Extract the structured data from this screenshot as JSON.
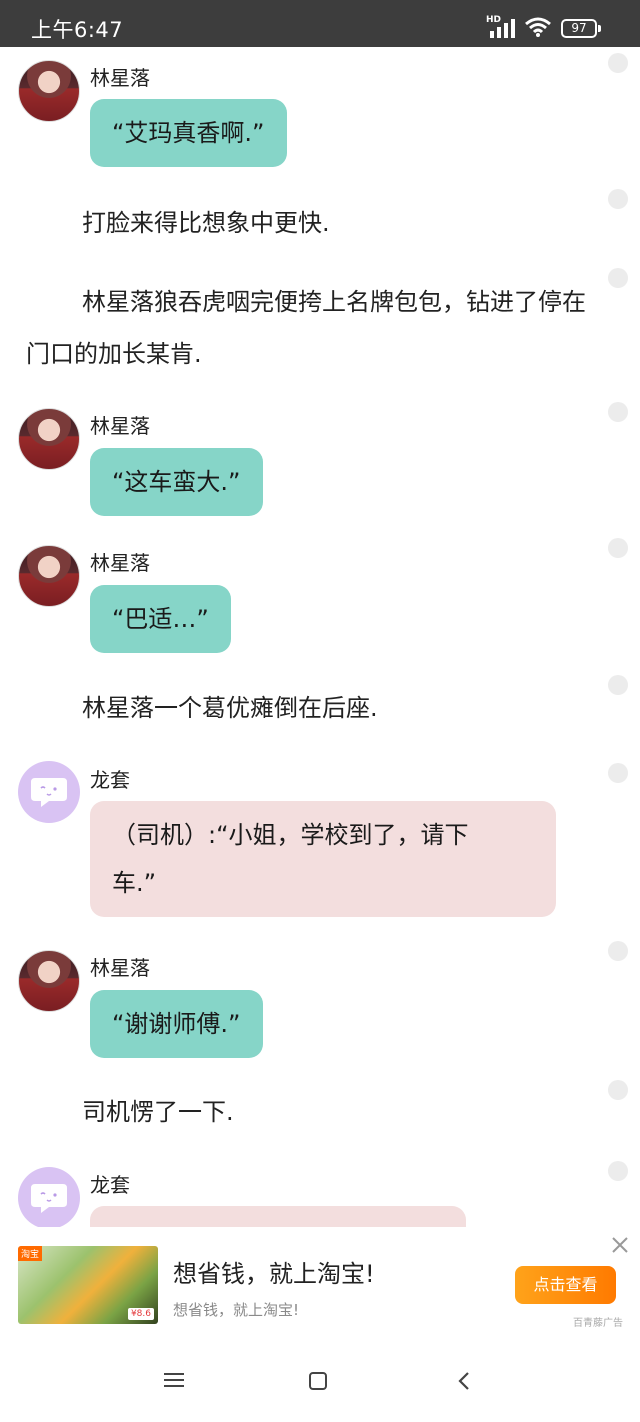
{
  "status_bar": {
    "time": "上午6:47",
    "network": "HD",
    "battery": "97"
  },
  "feed": [
    {
      "type": "chat",
      "speaker": "林星落",
      "avatar": "girl-photo",
      "text": "“艾玛真香啊.”",
      "style": "teal"
    },
    {
      "type": "narration",
      "text": "打脸来得比想象中更快."
    },
    {
      "type": "narration",
      "text": "林星落狼吞虎咽完便挎上名牌包包，钻进了停在门口的加长某肯."
    },
    {
      "type": "chat",
      "speaker": "林星落",
      "avatar": "girl-photo",
      "text": "“这车蛮大.”",
      "style": "teal"
    },
    {
      "type": "chat",
      "speaker": "林星落",
      "avatar": "girl-photo",
      "text": "“巴适…”",
      "style": "teal"
    },
    {
      "type": "narration",
      "text": "林星落一个葛优瘫倒在后座."
    },
    {
      "type": "chat",
      "speaker": "龙套",
      "avatar": "chat-bubble-icon",
      "text_lines": [
        "（司机）:“小姐，学校到了，请下",
        "车.”"
      ],
      "style": "pink"
    },
    {
      "type": "chat",
      "speaker": "林星落",
      "avatar": "girl-photo",
      "text": "“谢谢师傅.”",
      "style": "teal"
    },
    {
      "type": "narration",
      "text": "司机愣了一下."
    },
    {
      "type": "chat",
      "speaker": "龙套",
      "avatar": "chat-bubble-icon",
      "text": "",
      "style": "pink"
    }
  ],
  "ad": {
    "title": "想省钱，就上淘宝!",
    "subtitle": "想省钱，就上淘宝!",
    "cta": "点击查看",
    "brand": "百青藤广告",
    "thumb_tag": "淘宝",
    "thumb_price": "¥8.6"
  },
  "colors": {
    "teal_bubble": "#86d5c8",
    "pink_bubble": "#f3dede",
    "cta": "#ff8c00"
  }
}
